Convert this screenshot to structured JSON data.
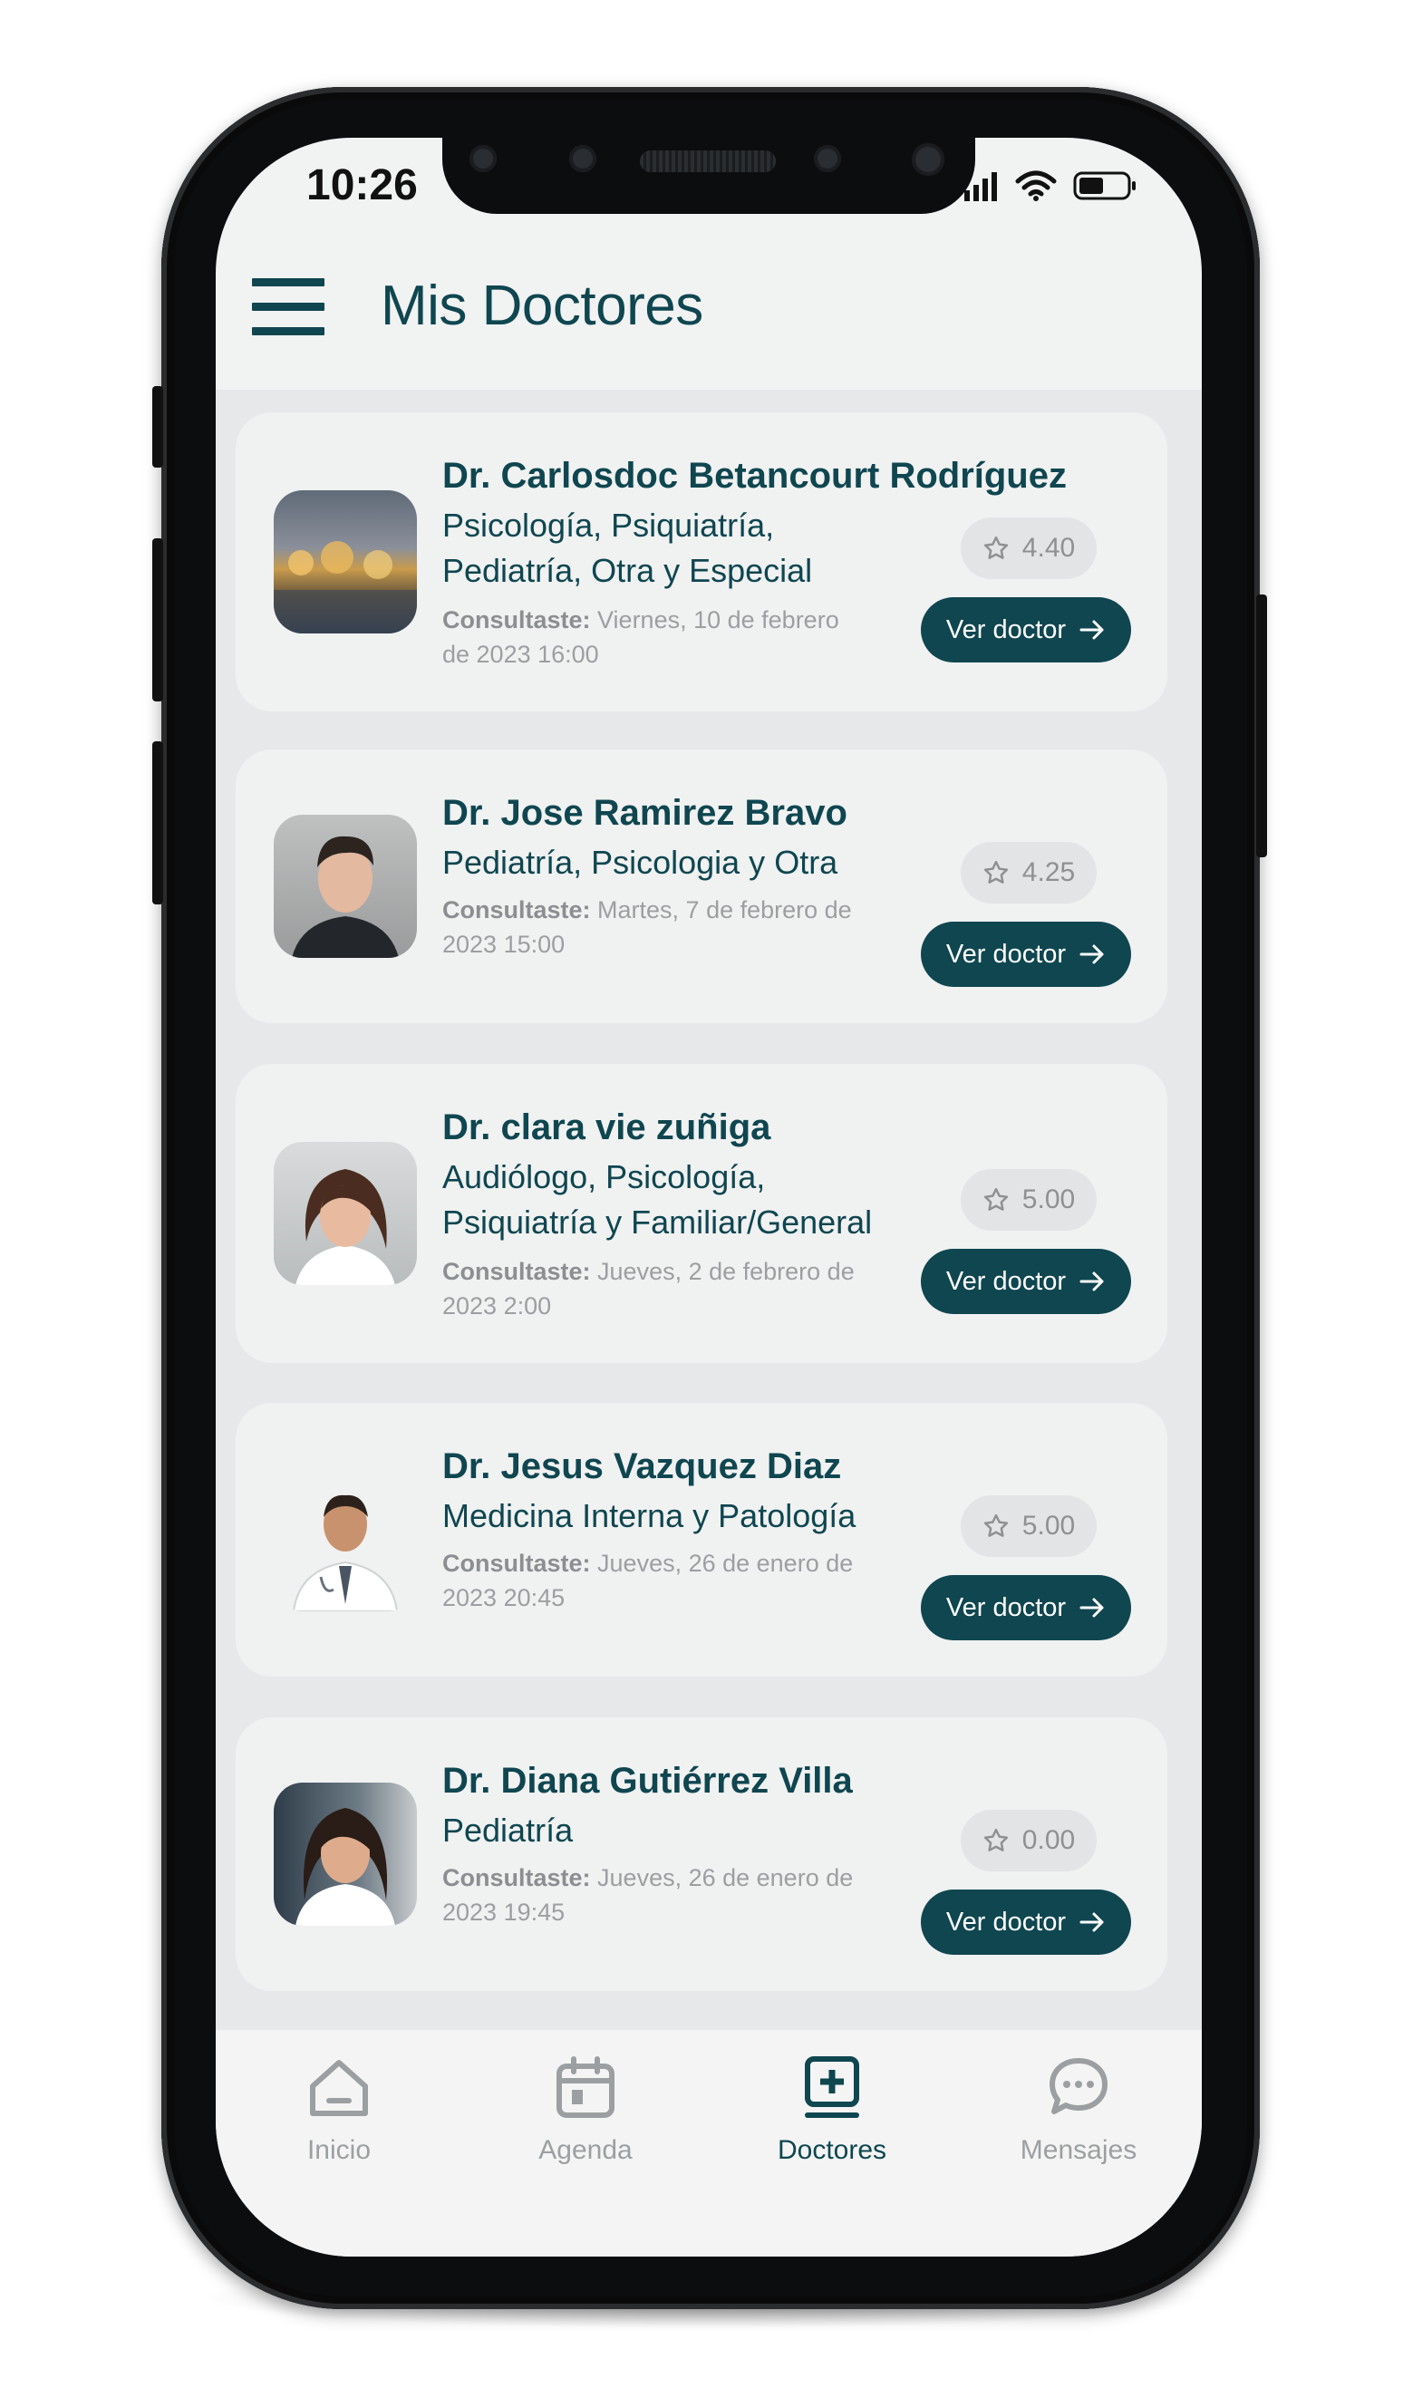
{
  "status_bar": {
    "time": "10:26"
  },
  "header": {
    "title": "Mis Doctores"
  },
  "doctors": [
    {
      "name": "Dr. Carlosdoc  Betancourt Rodríguez",
      "specialties_line1": "Psicología, Psiquiatría,",
      "specialties_line2": "Pediatría, Otra y Especial",
      "consult_label": "Consultaste:",
      "consult_date_line1": " Viernes, 10 de febrero",
      "consult_date_line2": "de 2023 16:00",
      "rating": "4.40",
      "button_label": "Ver doctor"
    },
    {
      "name": "Dr. Jose Ramirez Bravo",
      "specialties_line1": "Pediatría, Psicologia y Otra",
      "specialties_line2": "",
      "consult_label": "Consultaste:",
      "consult_date_line1": " Martes, 7 de febrero de",
      "consult_date_line2": "2023 15:00",
      "rating": "4.25",
      "button_label": "Ver doctor"
    },
    {
      "name": "Dr. clara vie zuñiga",
      "specialties_line1": "Audiólogo, Psicología,",
      "specialties_line2": "Psiquiatría y Familiar/General",
      "consult_label": "Consultaste:",
      "consult_date_line1": " Jueves, 2 de febrero de",
      "consult_date_line2": "2023 2:00",
      "rating": "5.00",
      "button_label": "Ver doctor"
    },
    {
      "name": "Dr. Jesus Vazquez  Diaz",
      "specialties_line1": "Medicina Interna  y Patología",
      "specialties_line2": "",
      "consult_label": "Consultaste:",
      "consult_date_line1": " Jueves, 26 de enero de",
      "consult_date_line2": "2023 20:45",
      "rating": "5.00",
      "button_label": "Ver doctor"
    },
    {
      "name": "Dr. Diana Gutiérrez  Villa",
      "specialties_line1": "Pediatría",
      "specialties_line2": "",
      "consult_label": "Consultaste:",
      "consult_date_line1": " Jueves, 26 de enero de",
      "consult_date_line2": "2023 19:45",
      "rating": "0.00",
      "button_label": "Ver doctor"
    }
  ],
  "bottom_nav": [
    {
      "label": "Inicio",
      "icon": "home-icon",
      "active": false
    },
    {
      "label": "Agenda",
      "icon": "calendar-icon",
      "active": false
    },
    {
      "label": "Doctores",
      "icon": "doctor-plus-icon",
      "active": true
    },
    {
      "label": "Mensajes",
      "icon": "chat-icon",
      "active": false
    }
  ],
  "colors": {
    "primary": "#0f4650",
    "muted_text": "#9c9fa1",
    "card_bg": "#f0f1f1",
    "list_bg": "#e6e8e9"
  }
}
